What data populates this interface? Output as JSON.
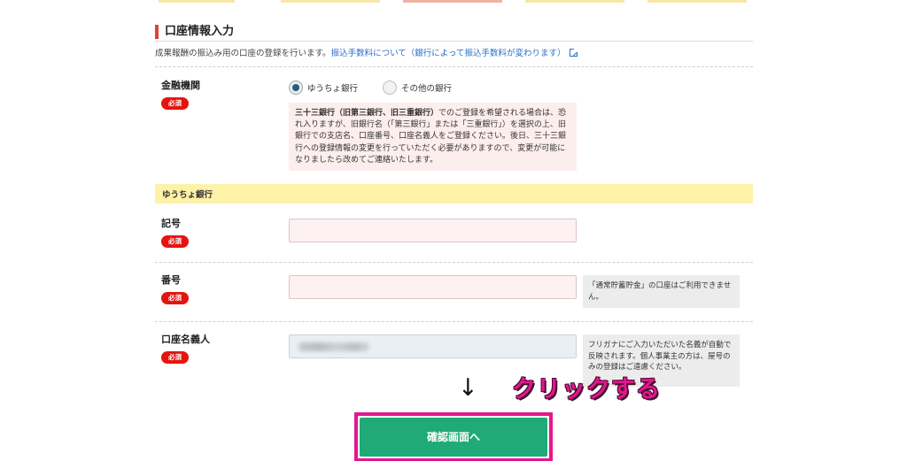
{
  "section": {
    "title": "口座情報入力",
    "description": "成果報酬の振込み用の口座の登録を行います。",
    "fee_link": "振込手数料について（銀行によって振込手数料が変わります）",
    "link_icon": "external-link-icon"
  },
  "institution": {
    "label": "金融機関",
    "required": "必須",
    "options": [
      {
        "label": "ゆうちょ銀行",
        "selected": true
      },
      {
        "label": "その他の銀行",
        "selected": false
      }
    ],
    "notice_bold": "三十三銀行（旧第三銀行、旧三重銀行）",
    "notice_rest": "でのご登録を希望される場合は、恐れ入りますが、旧銀行名（「第三銀行」または「三重銀行」）を選択の上、旧銀行での支店名、口座番号、口座名義人をご登録ください。後日、三十三銀行への登録情報の変更を行っていただく必要がありますので、変更が可能になりましたら改めてご連絡いたします。"
  },
  "bank_band": "ゆうちょ銀行",
  "fields": {
    "kigou": {
      "label": "記号",
      "required": "必須",
      "value": ""
    },
    "bangou": {
      "label": "番号",
      "required": "必須",
      "value": "",
      "hint": "「通常貯蓄貯金」の口座はご利用できません。"
    },
    "meigi": {
      "label": "口座名義人",
      "required": "必須",
      "hint": "フリガナにご入力いただいた名義が自動で反映されます。個人事業主の方は、屋号のみの登録はご遠慮ください。"
    }
  },
  "annotation": {
    "arrow": "↓",
    "text": "クリックする"
  },
  "submit_label": "確認画面へ",
  "colors": {
    "accent_red": "#e0413c",
    "required_red": "#e5140f",
    "band_yellow": "#fdf2a8",
    "button_green": "#1faa78",
    "highlight_pink": "#e5168d",
    "link_blue": "#2a6fc9"
  },
  "tab_colors": [
    "#f7e6a6",
    "#f7e6a6",
    "#efb5a4",
    "#f7e6a6",
    "#f7e6a6"
  ]
}
